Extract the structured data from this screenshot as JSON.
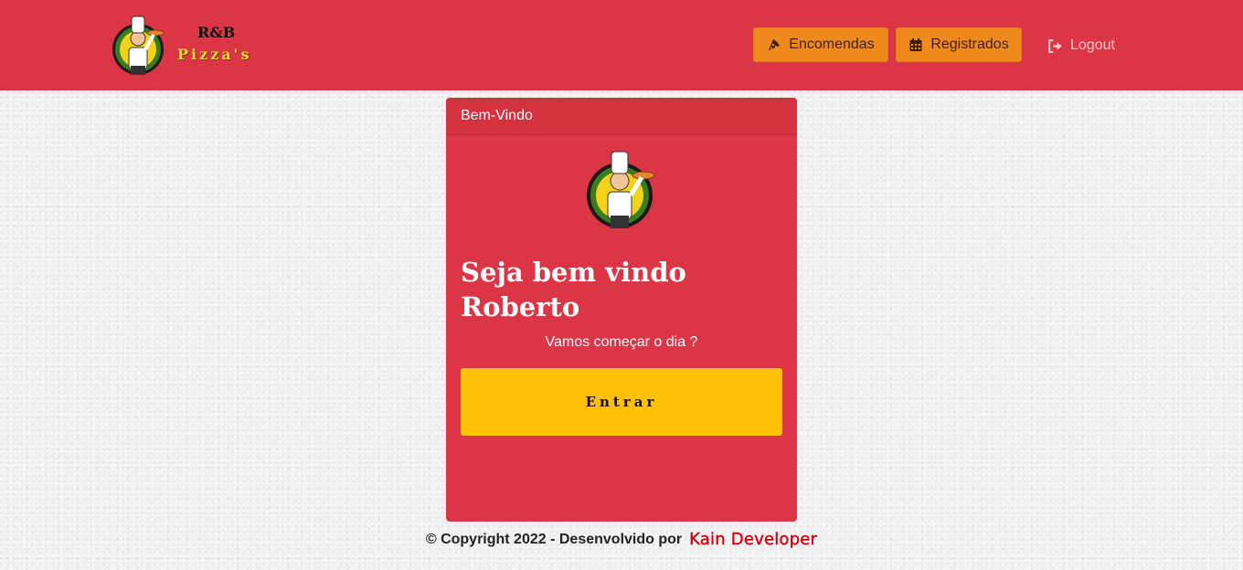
{
  "brand": {
    "line1": "R&B",
    "line2": "Pizza's",
    "logo_icon": "chef-logo-icon"
  },
  "nav": {
    "encomendas_label": "Encomendas",
    "encomendas_icon": "pizza-slice-icon",
    "registrados_label": "Registrados",
    "registrados_icon": "calendar-icon",
    "logout_label": "Logout",
    "logout_icon": "sign-out-icon"
  },
  "card": {
    "header": "Bem-Vindo",
    "welcome_line1": "Seja bem vindo",
    "welcome_line2": "Roberto",
    "subtitle": "Vamos começar o dia ?",
    "enter_label": "Entrar"
  },
  "footer": {
    "copyright": "© Copyright 2022 - Desenvolvido por",
    "author": "Kain Developer"
  },
  "colors": {
    "primary_red": "#dc3545",
    "nav_button": "#f0891c",
    "enter_button": "#ffc107",
    "author_red": "#d7000f"
  }
}
